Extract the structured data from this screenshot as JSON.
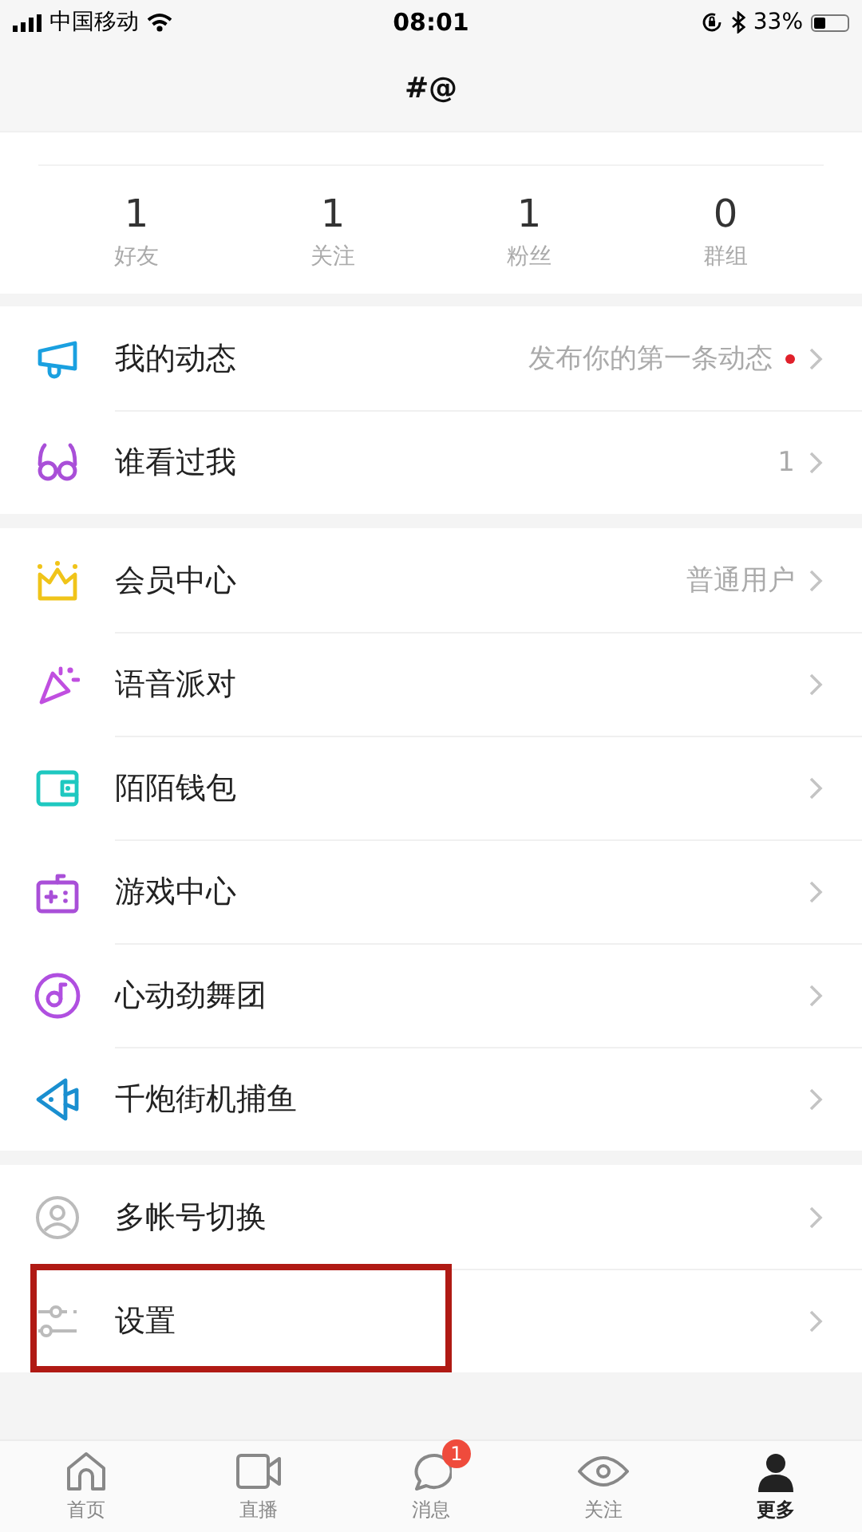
{
  "status_bar": {
    "carrier": "中国移动",
    "time": "08:01",
    "battery": "33%"
  },
  "header": {
    "title": "#@"
  },
  "stats": [
    {
      "value": "1",
      "label": "好友"
    },
    {
      "value": "1",
      "label": "关注"
    },
    {
      "value": "1",
      "label": "粉丝"
    },
    {
      "value": "0",
      "label": "群组"
    }
  ],
  "groups": [
    {
      "items": [
        {
          "kind": "megaphone",
          "color": "#1aa0e0",
          "label": "我的动态",
          "detail": "发布你的第一条动态",
          "dot": true
        },
        {
          "kind": "glasses",
          "color": "#a94fd8",
          "label": "谁看过我",
          "detail": "1",
          "dot": false
        }
      ]
    },
    {
      "items": [
        {
          "kind": "crown",
          "color": "#f0c419",
          "label": "会员中心",
          "detail": "普通用户",
          "dot": false
        },
        {
          "kind": "party",
          "color": "#c04fe0",
          "label": "语音派对",
          "dot": false
        },
        {
          "kind": "wallet",
          "color": "#1ec8c0",
          "label": "陌陌钱包",
          "dot": false
        },
        {
          "kind": "gamepad",
          "color": "#a94fd8",
          "label": "游戏中心",
          "dot": false
        },
        {
          "kind": "music",
          "color": "#b04fe0",
          "label": "心动劲舞团",
          "dot": false
        },
        {
          "kind": "fish",
          "color": "#1a8fd0",
          "label": "千炮街机捕鱼",
          "dot": false
        }
      ]
    },
    {
      "items": [
        {
          "kind": "person",
          "color": "#bbbbbb",
          "label": "多帐号切换",
          "dot": false,
          "highlighted": false
        },
        {
          "kind": "sliders",
          "color": "#bbbbbb",
          "label": "设置",
          "dot": false,
          "highlighted": true
        }
      ]
    }
  ],
  "tabs": [
    {
      "kind": "home",
      "label": "首页",
      "selected": false
    },
    {
      "kind": "video",
      "label": "直播",
      "selected": false
    },
    {
      "kind": "chat",
      "label": "消息",
      "badge": "1",
      "selected": false
    },
    {
      "kind": "eye",
      "label": "关注",
      "selected": false
    },
    {
      "kind": "user",
      "label": "更多",
      "selected": true
    }
  ]
}
